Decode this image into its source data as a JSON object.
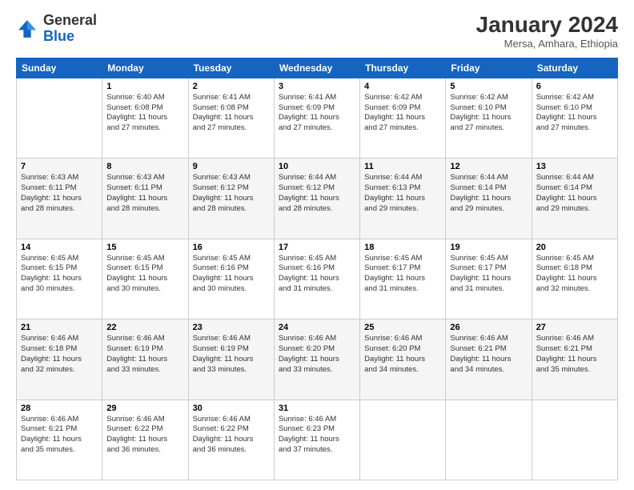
{
  "logo": {
    "general": "General",
    "blue": "Blue"
  },
  "title": "January 2024",
  "location": "Mersa, Amhara, Ethiopia",
  "days_of_week": [
    "Sunday",
    "Monday",
    "Tuesday",
    "Wednesday",
    "Thursday",
    "Friday",
    "Saturday"
  ],
  "weeks": [
    [
      {
        "day": "",
        "sunrise": "",
        "sunset": "",
        "daylight": ""
      },
      {
        "day": "1",
        "sunrise": "Sunrise: 6:40 AM",
        "sunset": "Sunset: 6:08 PM",
        "daylight": "Daylight: 11 hours and 27 minutes."
      },
      {
        "day": "2",
        "sunrise": "Sunrise: 6:41 AM",
        "sunset": "Sunset: 6:08 PM",
        "daylight": "Daylight: 11 hours and 27 minutes."
      },
      {
        "day": "3",
        "sunrise": "Sunrise: 6:41 AM",
        "sunset": "Sunset: 6:09 PM",
        "daylight": "Daylight: 11 hours and 27 minutes."
      },
      {
        "day": "4",
        "sunrise": "Sunrise: 6:42 AM",
        "sunset": "Sunset: 6:09 PM",
        "daylight": "Daylight: 11 hours and 27 minutes."
      },
      {
        "day": "5",
        "sunrise": "Sunrise: 6:42 AM",
        "sunset": "Sunset: 6:10 PM",
        "daylight": "Daylight: 11 hours and 27 minutes."
      },
      {
        "day": "6",
        "sunrise": "Sunrise: 6:42 AM",
        "sunset": "Sunset: 6:10 PM",
        "daylight": "Daylight: 11 hours and 27 minutes."
      }
    ],
    [
      {
        "day": "7",
        "sunrise": "Sunrise: 6:43 AM",
        "sunset": "Sunset: 6:11 PM",
        "daylight": "Daylight: 11 hours and 28 minutes."
      },
      {
        "day": "8",
        "sunrise": "Sunrise: 6:43 AM",
        "sunset": "Sunset: 6:11 PM",
        "daylight": "Daylight: 11 hours and 28 minutes."
      },
      {
        "day": "9",
        "sunrise": "Sunrise: 6:43 AM",
        "sunset": "Sunset: 6:12 PM",
        "daylight": "Daylight: 11 hours and 28 minutes."
      },
      {
        "day": "10",
        "sunrise": "Sunrise: 6:44 AM",
        "sunset": "Sunset: 6:12 PM",
        "daylight": "Daylight: 11 hours and 28 minutes."
      },
      {
        "day": "11",
        "sunrise": "Sunrise: 6:44 AM",
        "sunset": "Sunset: 6:13 PM",
        "daylight": "Daylight: 11 hours and 29 minutes."
      },
      {
        "day": "12",
        "sunrise": "Sunrise: 6:44 AM",
        "sunset": "Sunset: 6:14 PM",
        "daylight": "Daylight: 11 hours and 29 minutes."
      },
      {
        "day": "13",
        "sunrise": "Sunrise: 6:44 AM",
        "sunset": "Sunset: 6:14 PM",
        "daylight": "Daylight: 11 hours and 29 minutes."
      }
    ],
    [
      {
        "day": "14",
        "sunrise": "Sunrise: 6:45 AM",
        "sunset": "Sunset: 6:15 PM",
        "daylight": "Daylight: 11 hours and 30 minutes."
      },
      {
        "day": "15",
        "sunrise": "Sunrise: 6:45 AM",
        "sunset": "Sunset: 6:15 PM",
        "daylight": "Daylight: 11 hours and 30 minutes."
      },
      {
        "day": "16",
        "sunrise": "Sunrise: 6:45 AM",
        "sunset": "Sunset: 6:16 PM",
        "daylight": "Daylight: 11 hours and 30 minutes."
      },
      {
        "day": "17",
        "sunrise": "Sunrise: 6:45 AM",
        "sunset": "Sunset: 6:16 PM",
        "daylight": "Daylight: 11 hours and 31 minutes."
      },
      {
        "day": "18",
        "sunrise": "Sunrise: 6:45 AM",
        "sunset": "Sunset: 6:17 PM",
        "daylight": "Daylight: 11 hours and 31 minutes."
      },
      {
        "day": "19",
        "sunrise": "Sunrise: 6:45 AM",
        "sunset": "Sunset: 6:17 PM",
        "daylight": "Daylight: 11 hours and 31 minutes."
      },
      {
        "day": "20",
        "sunrise": "Sunrise: 6:45 AM",
        "sunset": "Sunset: 6:18 PM",
        "daylight": "Daylight: 11 hours and 32 minutes."
      }
    ],
    [
      {
        "day": "21",
        "sunrise": "Sunrise: 6:46 AM",
        "sunset": "Sunset: 6:18 PM",
        "daylight": "Daylight: 11 hours and 32 minutes."
      },
      {
        "day": "22",
        "sunrise": "Sunrise: 6:46 AM",
        "sunset": "Sunset: 6:19 PM",
        "daylight": "Daylight: 11 hours and 33 minutes."
      },
      {
        "day": "23",
        "sunrise": "Sunrise: 6:46 AM",
        "sunset": "Sunset: 6:19 PM",
        "daylight": "Daylight: 11 hours and 33 minutes."
      },
      {
        "day": "24",
        "sunrise": "Sunrise: 6:46 AM",
        "sunset": "Sunset: 6:20 PM",
        "daylight": "Daylight: 11 hours and 33 minutes."
      },
      {
        "day": "25",
        "sunrise": "Sunrise: 6:46 AM",
        "sunset": "Sunset: 6:20 PM",
        "daylight": "Daylight: 11 hours and 34 minutes."
      },
      {
        "day": "26",
        "sunrise": "Sunrise: 6:46 AM",
        "sunset": "Sunset: 6:21 PM",
        "daylight": "Daylight: 11 hours and 34 minutes."
      },
      {
        "day": "27",
        "sunrise": "Sunrise: 6:46 AM",
        "sunset": "Sunset: 6:21 PM",
        "daylight": "Daylight: 11 hours and 35 minutes."
      }
    ],
    [
      {
        "day": "28",
        "sunrise": "Sunrise: 6:46 AM",
        "sunset": "Sunset: 6:21 PM",
        "daylight": "Daylight: 11 hours and 35 minutes."
      },
      {
        "day": "29",
        "sunrise": "Sunrise: 6:46 AM",
        "sunset": "Sunset: 6:22 PM",
        "daylight": "Daylight: 11 hours and 36 minutes."
      },
      {
        "day": "30",
        "sunrise": "Sunrise: 6:46 AM",
        "sunset": "Sunset: 6:22 PM",
        "daylight": "Daylight: 11 hours and 36 minutes."
      },
      {
        "day": "31",
        "sunrise": "Sunrise: 6:46 AM",
        "sunset": "Sunset: 6:23 PM",
        "daylight": "Daylight: 11 hours and 37 minutes."
      },
      {
        "day": "",
        "sunrise": "",
        "sunset": "",
        "daylight": ""
      },
      {
        "day": "",
        "sunrise": "",
        "sunset": "",
        "daylight": ""
      },
      {
        "day": "",
        "sunrise": "",
        "sunset": "",
        "daylight": ""
      }
    ]
  ]
}
